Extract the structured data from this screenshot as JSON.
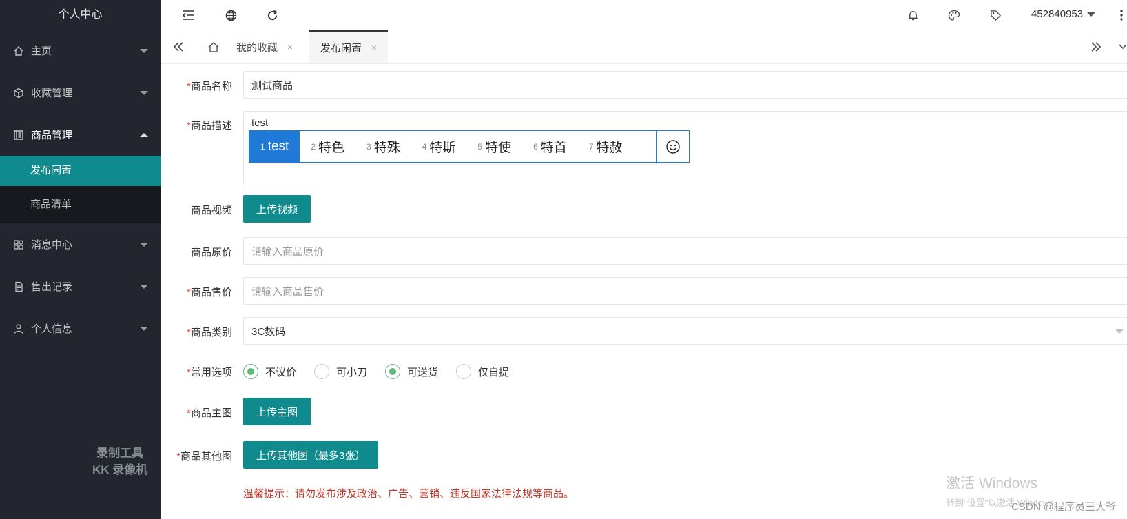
{
  "colors": {
    "accent": "#0f8b8d",
    "sidebar_bg": "#23262e",
    "required": "#e53935",
    "warning": "#c0392b",
    "ime": "#1e7ad6",
    "radio_on": "#5fb878"
  },
  "sidebar": {
    "title": "个人中心",
    "items": [
      {
        "label": "主页",
        "icon": "home-icon"
      },
      {
        "label": "收藏管理",
        "icon": "cube-icon"
      },
      {
        "label": "商品管理",
        "icon": "book-icon",
        "children": [
          {
            "label": "发布闲置",
            "active": true
          },
          {
            "label": "商品清单"
          }
        ]
      },
      {
        "label": "消息中心",
        "icon": "apps-icon"
      },
      {
        "label": "售出记录",
        "icon": "document-icon"
      },
      {
        "label": "个人信息",
        "icon": "user-icon"
      }
    ],
    "watermark": {
      "line1": "录制工具",
      "line2": "KK 录像机"
    }
  },
  "header": {
    "icons": [
      "menu-collapse-icon",
      "globe-icon",
      "refresh-icon",
      "bell-icon",
      "palette-icon",
      "tag-icon",
      "more-vertical-icon"
    ],
    "username": "452840953"
  },
  "tabs": [
    {
      "label": "我的收藏",
      "close": "×"
    },
    {
      "label": "发布闲置",
      "close": "×",
      "active": true
    }
  ],
  "form": {
    "name": {
      "label": "商品名称",
      "value": "测试商品"
    },
    "desc": {
      "label": "商品描述",
      "value": "test"
    },
    "ime": {
      "candidates": [
        {
          "n": "1",
          "text": "test"
        },
        {
          "n": "2",
          "text": "特色"
        },
        {
          "n": "3",
          "text": "特殊"
        },
        {
          "n": "4",
          "text": "特斯"
        },
        {
          "n": "5",
          "text": "特使"
        },
        {
          "n": "6",
          "text": "特首"
        },
        {
          "n": "7",
          "text": "特赦"
        }
      ],
      "emoji": "☺"
    },
    "video": {
      "label": "商品视频",
      "button": "上传视频"
    },
    "original_price": {
      "label": "商品原价",
      "placeholder": "请输入商品原价"
    },
    "sale_price": {
      "label": "商品售价",
      "placeholder": "请输入商品售价"
    },
    "category": {
      "label": "商品类别",
      "value": "3C数码"
    },
    "options": {
      "label": "常用选项",
      "items": [
        {
          "label": "不议价",
          "checked": true
        },
        {
          "label": "可小刀",
          "checked": false
        },
        {
          "label": "可送货",
          "checked": true
        },
        {
          "label": "仅自提",
          "checked": false
        }
      ]
    },
    "main_image": {
      "label": "商品主图",
      "button": "上传主图"
    },
    "other_images": {
      "label": "商品其他图",
      "button": "上传其他图（最多3张）"
    },
    "hint": "温馨提示：请勿发布涉及政治、广告、营销、违反国家法律法规等商品。"
  },
  "overlay": {
    "activation_title": "激活 Windows",
    "activation_sub": "转到\"设置\"以激活 Windows。",
    "credit": "CSDN @程序员王大爷"
  }
}
